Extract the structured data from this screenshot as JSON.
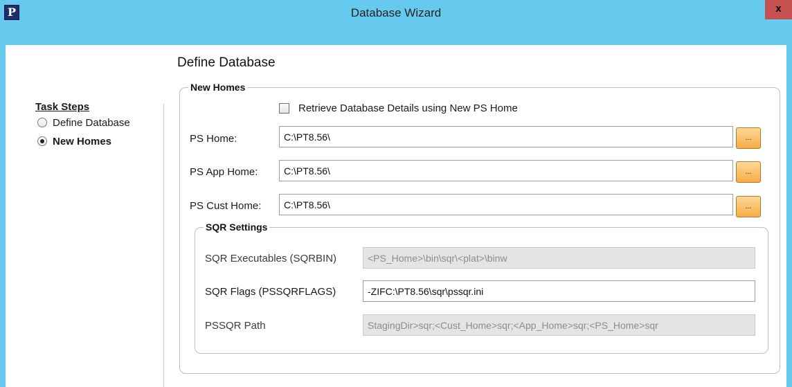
{
  "window": {
    "title": "Database Wizard",
    "app_icon_letter": "P",
    "close_label": "x",
    "frame_color": "#66c9ee"
  },
  "page_title": "Define Database",
  "task_steps": {
    "title": "Task Steps",
    "items": [
      {
        "label": "Define Database",
        "selected": false
      },
      {
        "label": "New Homes",
        "selected": true
      }
    ]
  },
  "new_homes": {
    "legend": "New Homes",
    "retrieve_checkbox": {
      "label": "Retrieve Database Details using New PS Home",
      "checked": false
    },
    "ps_home": {
      "label": "PS Home:",
      "value": "C:\\PT8.56\\",
      "browse_label": "..."
    },
    "ps_app_home": {
      "label": "PS App Home:",
      "value": "C:\\PT8.56\\",
      "browse_label": "..."
    },
    "ps_cust_home": {
      "label": "PS Cust Home:",
      "value": "C:\\PT8.56\\",
      "browse_label": "..."
    }
  },
  "sqr_settings": {
    "legend": "SQR Settings",
    "executables": {
      "label": "SQR Executables (SQRBIN)",
      "value": "<PS_Home>\\bin\\sqr\\<plat>\\binw",
      "disabled": true
    },
    "flags": {
      "label": "SQR Flags (PSSQRFLAGS)",
      "value": "-ZIFC:\\PT8.56\\sqr\\pssqr.ini",
      "disabled": false
    },
    "path": {
      "label": "PSSQR Path",
      "value": "StagingDir>sqr;<Cust_Home>sqr;<App_Home>sqr;<PS_Home>sqr",
      "disabled": true
    }
  },
  "colors": {
    "browse_button": "#f7ac46",
    "disabled_field": "#e4e4e4"
  }
}
